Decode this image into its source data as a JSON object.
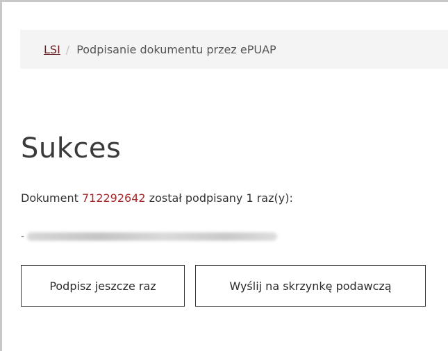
{
  "breadcrumb": {
    "root_label": "LSI",
    "separator": "/",
    "current_label": "Podpisanie dokumentu przez ePUAP"
  },
  "page_title": "Sukces",
  "status": {
    "prefix": "Dokument ",
    "document_number": "712292642",
    "suffix": " został podpisany 1 raz(y):"
  },
  "signer": {
    "bullet": "-"
  },
  "buttons": {
    "sign_again_label": "Podpisz jeszcze raz",
    "send_label": "Wyślij na skrzynkę podawczą"
  },
  "colors": {
    "link": "#6b1d1d",
    "document_number": "#a32a2a",
    "breadcrumb_bg": "#f4f4f4",
    "border": "#c8c8c8"
  }
}
